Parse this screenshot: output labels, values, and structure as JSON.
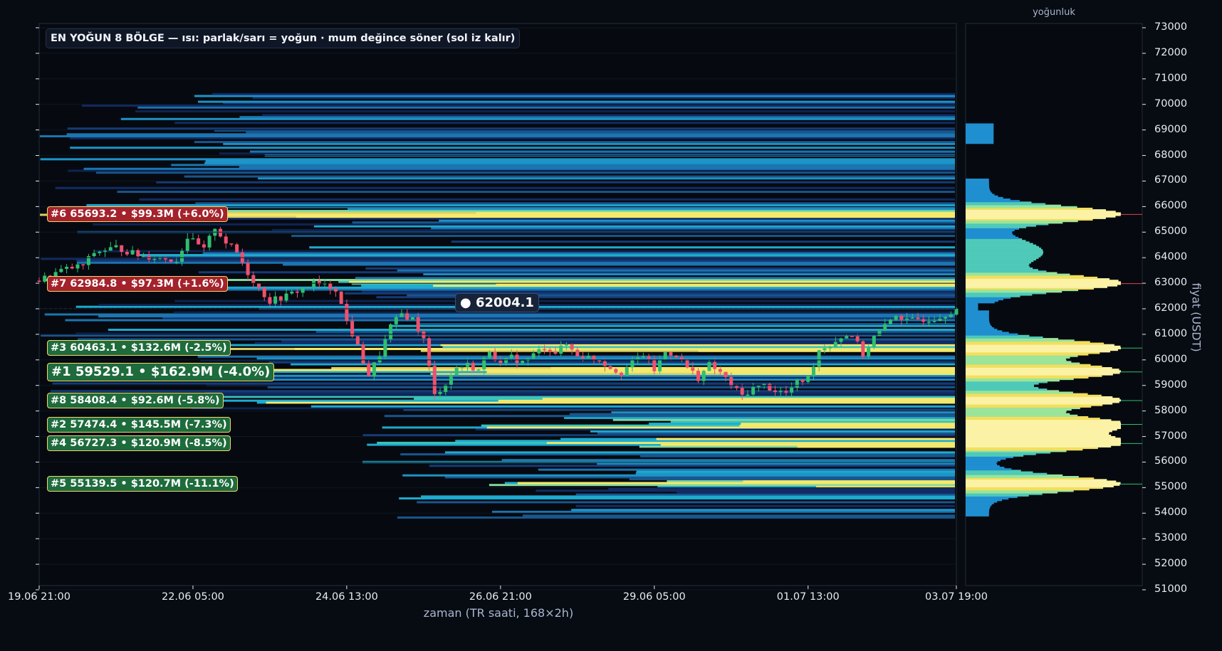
{
  "chart_data": {
    "type": "candlestick-heatmap",
    "title": "EN YOĞUN 8 BÖLGE — ısı: parlak/sarı = yoğun · mum değince söner (sol iz kalır)",
    "xlabel": "zaman (TR saati, 168×2h)",
    "ylabel": "fiyat (USDT)",
    "profile_title": "yoğunluk",
    "current_price_label": "● 62004.1",
    "current_price": 62004.1,
    "ylim": [
      51000,
      73000
    ],
    "y_ticks": [
      "51000",
      "52000",
      "53000",
      "54000",
      "55000",
      "56000",
      "57000",
      "58000",
      "59000",
      "60000",
      "61000",
      "62000",
      "63000",
      "64000",
      "65000",
      "66000",
      "67000",
      "68000",
      "69000",
      "70000",
      "71000",
      "72000",
      "73000"
    ],
    "x_ticks": [
      "19.06 21:00",
      "22.06 05:00",
      "24.06 13:00",
      "26.06 21:00",
      "29.06 05:00",
      "01.07 13:00",
      "03.07 19:00"
    ],
    "zones": [
      {
        "rank": 6,
        "price": 65693.2,
        "label": "#6  65693.2  •  $99.3M  (+6.0%)",
        "side": "above"
      },
      {
        "rank": 7,
        "price": 62984.8,
        "label": "#7  62984.8  •  $97.3M  (+1.6%)",
        "side": "above"
      },
      {
        "rank": 3,
        "price": 60463.1,
        "label": "#3  60463.1  •  $132.6M  (-2.5%)",
        "side": "below"
      },
      {
        "rank": 1,
        "price": 59529.1,
        "label": "#1  59529.1  •  $162.9M  (-4.0%)",
        "side": "below"
      },
      {
        "rank": 8,
        "price": 58408.4,
        "label": "#8  58408.4  •  $92.6M  (-5.8%)",
        "side": "below"
      },
      {
        "rank": 2,
        "price": 57474.4,
        "label": "#2  57474.4  •  $145.5M  (-7.3%)",
        "side": "below"
      },
      {
        "rank": 4,
        "price": 56727.3,
        "label": "#4  56727.3  •  $120.9M  (-8.5%)",
        "side": "below"
      },
      {
        "rank": 5,
        "price": 55139.5,
        "label": "#5  55139.5  •  $120.7M  (-11.1%)",
        "side": "below"
      }
    ],
    "colors": {
      "up": "#2fbf71",
      "down": "#f0506e",
      "heat_low": "#12306a",
      "heat_mid": "#1fa8dd",
      "heat_high": "#f6e96b",
      "background": "#070b12"
    },
    "close_path": [
      [
        0,
        63100
      ],
      [
        4,
        63500
      ],
      [
        8,
        63700
      ],
      [
        10,
        64200
      ],
      [
        14,
        64400
      ],
      [
        18,
        64100
      ],
      [
        22,
        64000
      ],
      [
        25,
        63900
      ],
      [
        27,
        64800
      ],
      [
        30,
        64300
      ],
      [
        32,
        65200
      ],
      [
        34,
        64600
      ],
      [
        36,
        64200
      ],
      [
        38,
        63400
      ],
      [
        40,
        62800
      ],
      [
        42,
        62300
      ],
      [
        45,
        62500
      ],
      [
        48,
        62800
      ],
      [
        50,
        63000
      ],
      [
        52,
        62900
      ],
      [
        54,
        62800
      ],
      [
        56,
        61500
      ],
      [
        58,
        60500
      ],
      [
        60,
        59400
      ],
      [
        62,
        60200
      ],
      [
        64,
        61300
      ],
      [
        66,
        61800
      ],
      [
        68,
        61600
      ],
      [
        70,
        60800
      ],
      [
        72,
        58600
      ],
      [
        74,
        59100
      ],
      [
        76,
        59700
      ],
      [
        78,
        59800
      ],
      [
        80,
        59600
      ],
      [
        82,
        60400
      ],
      [
        84,
        59800
      ],
      [
        86,
        60100
      ],
      [
        88,
        59900
      ],
      [
        90,
        60200
      ],
      [
        92,
        60500
      ],
      [
        94,
        60300
      ],
      [
        96,
        60600
      ],
      [
        98,
        60200
      ],
      [
        100,
        60100
      ],
      [
        102,
        60000
      ],
      [
        104,
        59700
      ],
      [
        106,
        59500
      ],
      [
        108,
        59900
      ],
      [
        110,
        60200
      ],
      [
        112,
        59600
      ],
      [
        114,
        60300
      ],
      [
        116,
        60200
      ],
      [
        118,
        59700
      ],
      [
        120,
        59300
      ],
      [
        122,
        59800
      ],
      [
        124,
        59500
      ],
      [
        126,
        59000
      ],
      [
        128,
        58600
      ],
      [
        130,
        58900
      ],
      [
        132,
        59000
      ],
      [
        134,
        58800
      ],
      [
        136,
        58700
      ],
      [
        138,
        59100
      ],
      [
        140,
        59300
      ],
      [
        142,
        60400
      ],
      [
        144,
        60600
      ],
      [
        146,
        60900
      ],
      [
        148,
        61000
      ],
      [
        150,
        60200
      ],
      [
        152,
        60900
      ],
      [
        154,
        61300
      ],
      [
        156,
        61800
      ],
      [
        158,
        61500
      ],
      [
        160,
        61600
      ],
      [
        162,
        61600
      ],
      [
        164,
        61700
      ],
      [
        166,
        61900
      ],
      [
        167,
        62004
      ]
    ]
  }
}
